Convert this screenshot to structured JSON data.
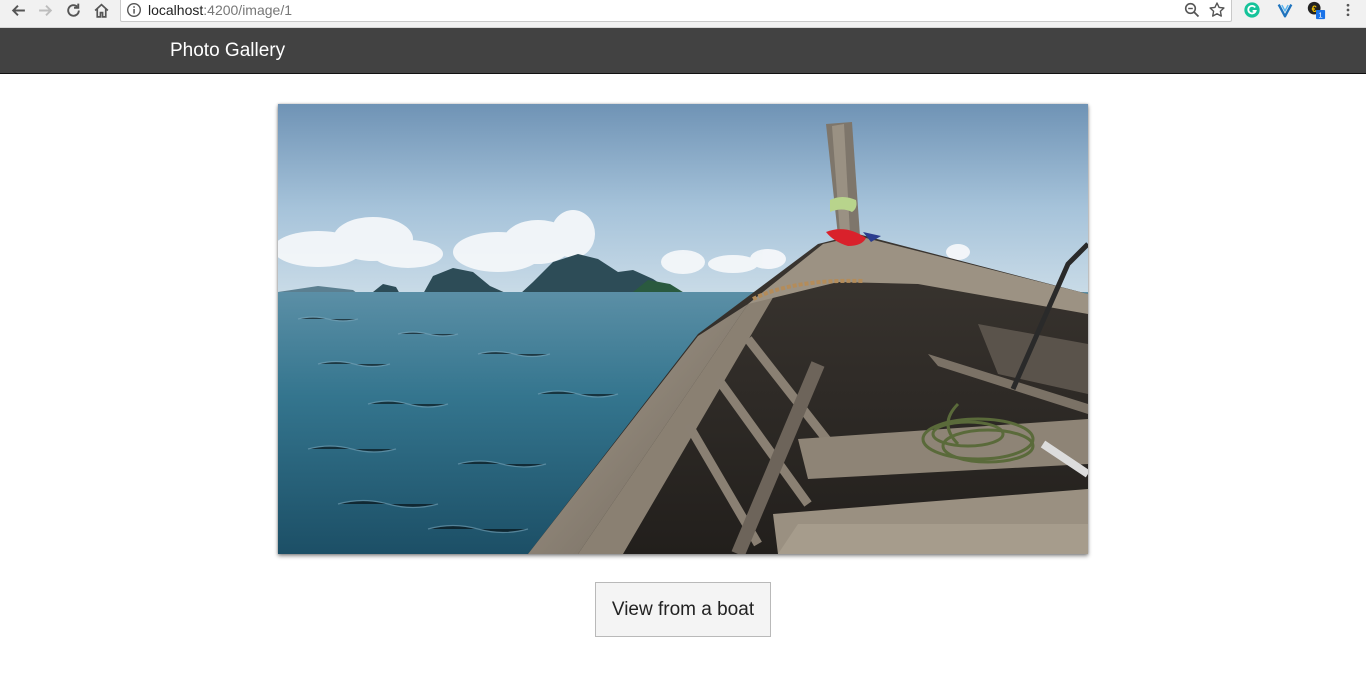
{
  "browser": {
    "url_host": "localhost",
    "url_path": ":4200/image/1",
    "extension_badge": "1"
  },
  "app": {
    "title": "Photo Gallery"
  },
  "photo": {
    "subject": "Boat bow on turquoise sea with limestone islands"
  },
  "caption": {
    "label": "View from a boat"
  },
  "colors": {
    "header_bg": "#424242",
    "sea": "#2f6a80",
    "sky": "#a9c6dc"
  }
}
